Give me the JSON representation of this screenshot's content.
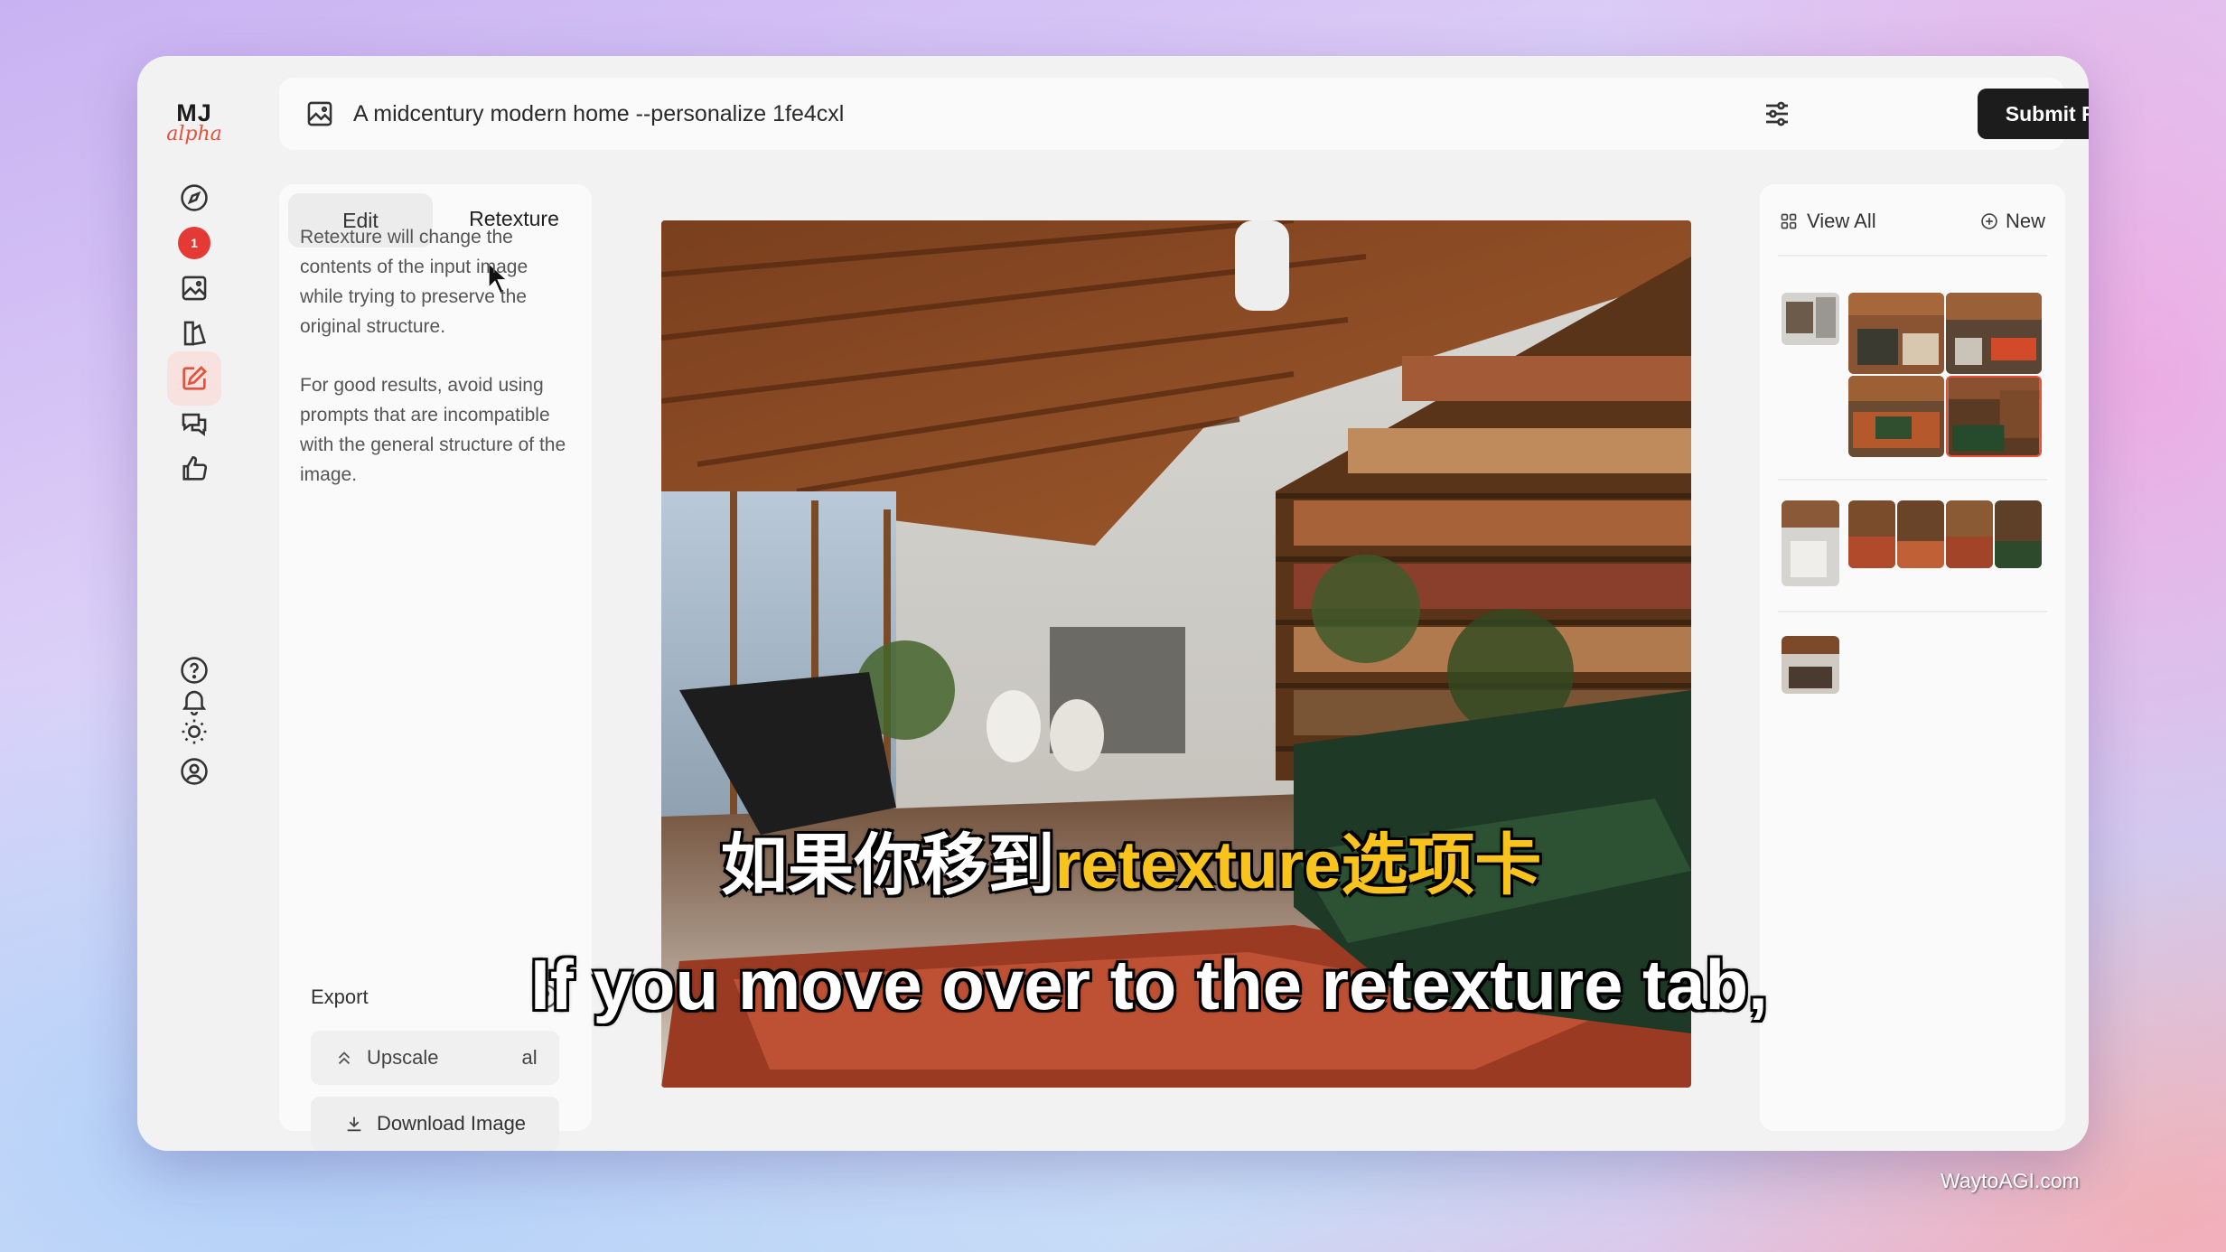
{
  "app": {
    "logo_top": "MJ",
    "logo_bottom": "alpha",
    "notification_count": "1"
  },
  "rail": {
    "items": [
      {
        "name": "explore",
        "icon": "compass-icon"
      },
      {
        "name": "notifications",
        "icon": "red-dot-icon"
      },
      {
        "name": "create",
        "icon": "image-icon"
      },
      {
        "name": "organize",
        "icon": "folder-icon"
      },
      {
        "name": "edit",
        "icon": "edit-icon",
        "active": true
      },
      {
        "name": "chat",
        "icon": "chat-icon"
      },
      {
        "name": "rank",
        "icon": "thumbs-up-icon"
      }
    ],
    "bottom": [
      "help-icon",
      "bell-icon",
      "sun-icon",
      "user-icon"
    ]
  },
  "topbar": {
    "prompt": "A midcentury modern home --personalize 1fe4cxl",
    "submit_label": "Submit Retexture"
  },
  "left_panel": {
    "tabs": [
      {
        "label": "Edit",
        "active": false
      },
      {
        "label": "Retexture",
        "active": true
      }
    ],
    "description_1": "Retexture will change the contents of the input image while trying to preserve the original structure.",
    "description_2": "For good results, avoid using prompts that are incompatible with the general structure of the image.",
    "export_label": "Export",
    "upscale_label": "Upscale",
    "upscale_suffix": "al",
    "download_label": "Download Image"
  },
  "right_panel": {
    "view_all_label": "View All",
    "new_label": "New"
  },
  "subtitles": {
    "cn_prefix": "如果你移到",
    "cn_highlight": "retexture选项卡",
    "en": "If you move over to the retexture tab,"
  },
  "watermark": "WaytoAGI.com",
  "colors": {
    "accent": "#e8503c",
    "submit_bg": "#1c1c1c",
    "subtitle_highlight": "#f7c31c"
  }
}
